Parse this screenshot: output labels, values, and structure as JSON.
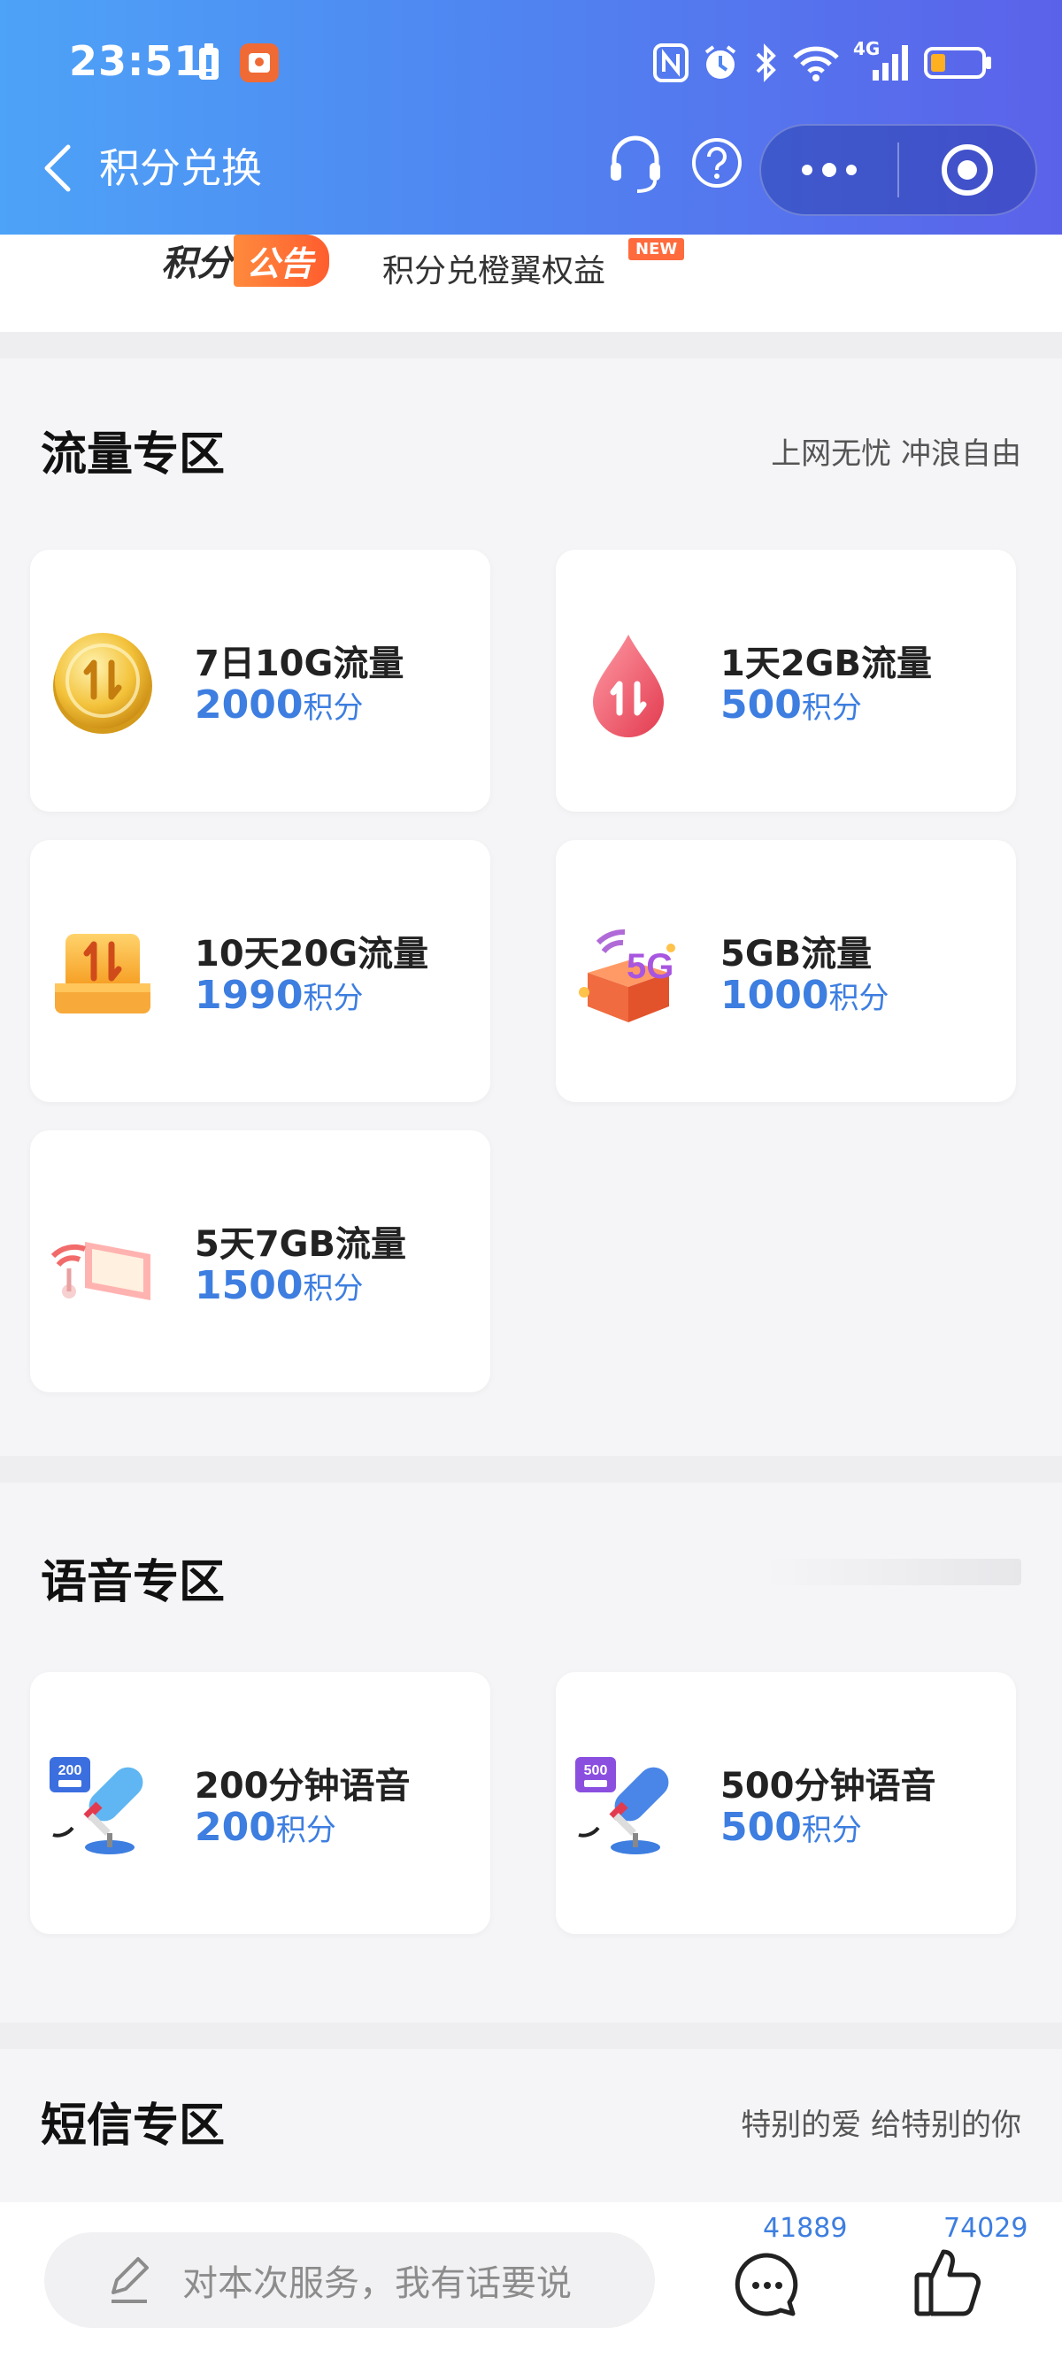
{
  "status_bar": {
    "time": "23:51",
    "network": "4G"
  },
  "nav": {
    "title": "积分兑换"
  },
  "announcement": {
    "badge_left": "积分",
    "badge_right": "公告",
    "text": "积分兑橙翼权益",
    "new_tag": "NEW"
  },
  "sections": {
    "traffic": {
      "title": "流量专区",
      "subtitle": "上网无忧 冲浪自由",
      "items": [
        {
          "name": "7日10G流量",
          "points": "2000",
          "unit": "积分",
          "icon": "gold-coin-icon"
        },
        {
          "name": "1天2GB流量",
          "points": "500",
          "unit": "积分",
          "icon": "red-drop-icon"
        },
        {
          "name": "10天20G流量",
          "points": "1990",
          "unit": "积分",
          "icon": "orange-box-icon"
        },
        {
          "name": "5GB流量",
          "points": "1000",
          "unit": "积分",
          "icon": "5g-gift-icon"
        },
        {
          "name": "5天7GB流量",
          "points": "1500",
          "unit": "积分",
          "icon": "signal-card-icon"
        }
      ]
    },
    "voice": {
      "title": "语音专区",
      "items": [
        {
          "name": "200分钟语音",
          "points": "200",
          "unit": "积分",
          "icon": "microphone-icon",
          "badge": "200"
        },
        {
          "name": "500分钟语音",
          "points": "500",
          "unit": "积分",
          "icon": "microphone-icon",
          "badge": "500"
        }
      ]
    },
    "sms": {
      "title": "短信专区",
      "subtitle": "特别的爱 给特别的你"
    }
  },
  "bottom_bar": {
    "placeholder": "对本次服务，我有话要说",
    "comment_count": "41889",
    "like_count": "74029"
  },
  "colors": {
    "header_start": "#4da3f7",
    "header_end": "#5b62ea",
    "accent_blue": "#3d7ee0"
  }
}
